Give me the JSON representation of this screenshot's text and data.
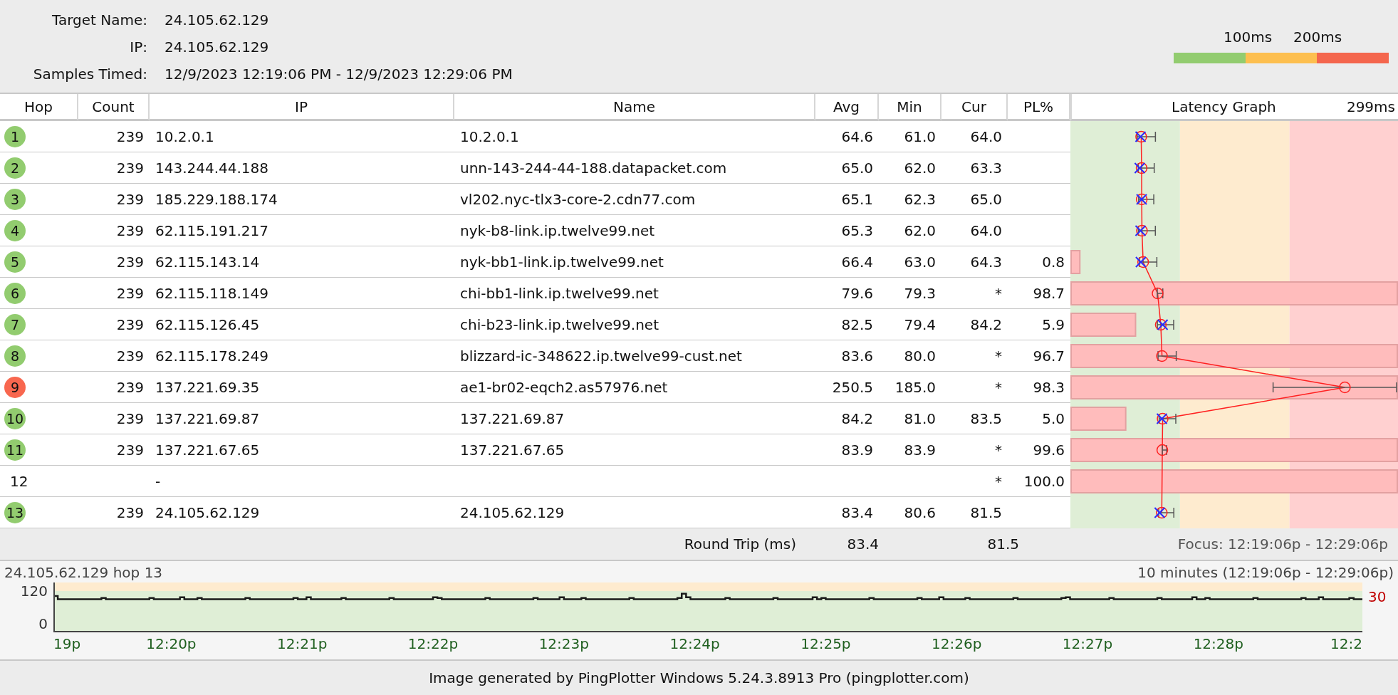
{
  "target": {
    "fields": [
      {
        "label": "Target Name:",
        "value": "24.105.62.129"
      },
      {
        "label": "IP:",
        "value": "24.105.62.129"
      },
      {
        "label": "Samples Timed:",
        "value": "12/9/2023 12:19:06 PM - 12/9/2023 12:29:06 PM"
      }
    ]
  },
  "legend": {
    "labels": [
      "100ms",
      "200ms"
    ]
  },
  "table": {
    "columns": [
      "Hop",
      "Count",
      "IP",
      "Name",
      "Avg",
      "Min",
      "Cur",
      "PL%"
    ],
    "graph_header": {
      "title": "Latency Graph",
      "max": "299ms"
    },
    "hops": [
      {
        "hop": "1",
        "color": "#92cc6f",
        "count": "239",
        "ip": "10.2.0.1",
        "name": "10.2.0.1",
        "avg": "64.6",
        "min": "61.0",
        "cur": "64.0"
      },
      {
        "hop": "2",
        "color": "#92cc6f",
        "count": "239",
        "ip": "143.244.44.188",
        "name": "unn-143-244-44-188.datapacket.com",
        "avg": "65.0",
        "min": "62.0",
        "cur": "63.3"
      },
      {
        "hop": "3",
        "color": "#92cc6f",
        "count": "239",
        "ip": "185.229.188.174",
        "name": "vl202.nyc-tlx3-core-2.cdn77.com",
        "avg": "65.1",
        "min": "62.3",
        "cur": "65.0"
      },
      {
        "hop": "4",
        "color": "#92cc6f",
        "count": "239",
        "ip": "62.115.191.217",
        "name": "nyk-b8-link.ip.twelve99.net",
        "avg": "65.3",
        "min": "62.0",
        "cur": "64.0"
      },
      {
        "hop": "5",
        "color": "#92cc6f",
        "count": "239",
        "ip": "62.115.143.14",
        "name": "nyk-bb1-link.ip.twelve99.net",
        "avg": "66.4",
        "min": "63.0",
        "cur": "64.3",
        "pl": "0.8"
      },
      {
        "hop": "6",
        "color": "#92cc6f",
        "count": "239",
        "ip": "62.115.118.149",
        "name": "chi-bb1-link.ip.twelve99.net",
        "avg": "79.6",
        "min": "79.3",
        "cur": "*",
        "pl": "98.7"
      },
      {
        "hop": "7",
        "color": "#92cc6f",
        "count": "239",
        "ip": "62.115.126.45",
        "name": "chi-b23-link.ip.twelve99.net",
        "avg": "82.5",
        "min": "79.4",
        "cur": "84.2",
        "pl": "5.9"
      },
      {
        "hop": "8",
        "color": "#92cc6f",
        "count": "239",
        "ip": "62.115.178.249",
        "name": "blizzard-ic-348622.ip.twelve99-cust.net",
        "avg": "83.6",
        "min": "80.0",
        "cur": "*",
        "pl": "96.7"
      },
      {
        "hop": "9",
        "color": "#f8674f",
        "count": "239",
        "ip": "137.221.69.35",
        "name": "ae1-br02-eqch2.as57976.net",
        "avg": "250.5",
        "min": "185.0",
        "cur": "*",
        "pl": "98.3"
      },
      {
        "hop": "10",
        "color": "#92cc6f",
        "count": "239",
        "ip": "137.221.69.87",
        "name": "137.221.69.87",
        "avg": "84.2",
        "min": "81.0",
        "cur": "83.5",
        "pl": "5.0"
      },
      {
        "hop": "11",
        "color": "#92cc6f",
        "count": "239",
        "ip": "137.221.67.65",
        "name": "137.221.67.65",
        "avg": "83.9",
        "min": "83.9",
        "cur": "*",
        "pl": "99.6"
      },
      {
        "hop": "12",
        "ip": "-",
        "cur": "*",
        "pl": "100.0"
      },
      {
        "hop": "13",
        "color": "#92cc6f",
        "count": "239",
        "ip": "24.105.62.129",
        "name": "24.105.62.129",
        "avg": "83.4",
        "min": "80.6",
        "cur": "81.5"
      }
    ],
    "round_trip": {
      "label": "Round Trip (ms)",
      "avg": "83.4",
      "cur": "81.5",
      "focus": "Focus: 12:19:06p - 12:29:06p"
    }
  },
  "timeline": {
    "title": "24.105.62.129 hop 13",
    "range": "10 minutes (12:19:06p - 12:29:06p)",
    "y_labels": [
      "120",
      "0"
    ],
    "pl_scale": "30",
    "x_labels": [
      "19p",
      "12:20p",
      "12:21p",
      "12:22p",
      "12:23p",
      "12:24p",
      "12:25p",
      "12:26p",
      "12:27p",
      "12:28p",
      "12:2"
    ]
  },
  "footer": "Image generated by PingPlotter Windows 5.24.3.8913 Pro (pingplotter.com)"
}
